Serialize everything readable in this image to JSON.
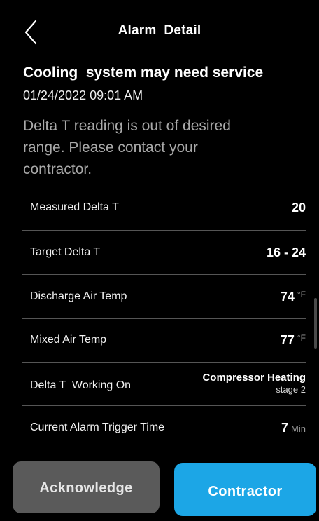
{
  "header": {
    "back_icon": "chevron-left-icon",
    "title": "Alarm  Detail"
  },
  "alarm": {
    "title": "Cooling  system may need service",
    "timestamp": "01/24/2022 09:01 AM",
    "description": "Delta T reading is out of desired\nrange.  Please contact your\ncontractor."
  },
  "details": [
    {
      "label": "Measured Delta T",
      "value": "20",
      "unit": ""
    },
    {
      "label": "Target Delta T",
      "value": "16 - 24",
      "unit": ""
    },
    {
      "label": "Discharge Air Temp",
      "value": "74",
      "unit": "°F"
    },
    {
      "label": "Mixed Air Temp",
      "value": "77",
      "unit": "°F"
    },
    {
      "label": "Delta T  Working On",
      "value": "Compressor Heating",
      "sub": "stage 2"
    },
    {
      "label": "Current Alarm Trigger Time",
      "value": "7",
      "unit": "Min"
    }
  ],
  "buttons": {
    "acknowledge": "Acknowledge",
    "contractor": "Contractor"
  },
  "colors": {
    "background": "#000000",
    "acknowledge_button": "#5a5a5a",
    "contractor_button": "#1ca6e6",
    "description_text": "#a9a9a9",
    "divider": "#555555"
  }
}
